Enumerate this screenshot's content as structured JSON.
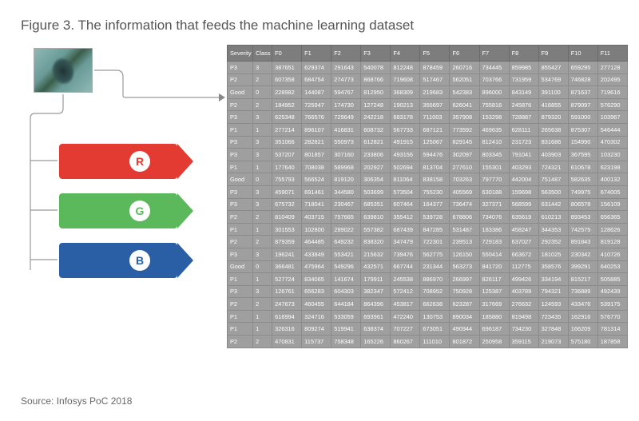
{
  "title": "Figure 3. The information that feeds the machine learning dataset",
  "source": "Source: Infosys PoC 2018",
  "channels": {
    "r": "R",
    "g": "G",
    "b": "B"
  },
  "columns": [
    "Severity",
    "Class",
    "F0",
    "F1",
    "F2",
    "F3",
    "F4",
    "F5",
    "F6",
    "F7",
    "F8",
    "F9",
    "F10",
    "F11"
  ],
  "rows": [
    [
      "P3",
      "3",
      "387651",
      "629374",
      "291643",
      "540078",
      "812248",
      "878459",
      "260716",
      "734445",
      "859985",
      "855427",
      "659295",
      "277128"
    ],
    [
      "P2",
      "2",
      "607358",
      "684754",
      "274773",
      "868766",
      "719608",
      "517467",
      "562051",
      "703766",
      "731959",
      "534769",
      "746828",
      "202495"
    ],
    [
      "Good",
      "0",
      "228982",
      "144087",
      "594767",
      "812950",
      "368309",
      "219683",
      "542383",
      "896000",
      "843149",
      "391100",
      "871637",
      "719616"
    ],
    [
      "P2",
      "2",
      "184952",
      "725947",
      "174730",
      "127248",
      "190213",
      "355697",
      "626041",
      "755816",
      "245876",
      "416855",
      "879097",
      "576290"
    ],
    [
      "P3",
      "3",
      "625348",
      "766576",
      "729649",
      "242218",
      "683178",
      "711003",
      "357908",
      "153298",
      "728887",
      "879320",
      "591000",
      "103967"
    ],
    [
      "P1",
      "1",
      "277214",
      "896107",
      "416831",
      "608732",
      "567733",
      "687121",
      "773592",
      "469635",
      "628111",
      "265638",
      "875307",
      "546444"
    ],
    [
      "P3",
      "3",
      "351066",
      "282821",
      "550973",
      "612821",
      "491915",
      "125067",
      "829145",
      "812410",
      "231723",
      "831686",
      "154990",
      "470302"
    ],
    [
      "P3",
      "3",
      "537207",
      "801857",
      "307160",
      "233806",
      "493156",
      "594476",
      "302097",
      "803345",
      "791041",
      "403903",
      "367595",
      "103230"
    ],
    [
      "P1",
      "1",
      "177640",
      "708038",
      "589968",
      "202927",
      "502694",
      "813704",
      "277610",
      "155301",
      "403293",
      "724321",
      "610678",
      "623198"
    ],
    [
      "Good",
      "0",
      "755793",
      "566524",
      "819120",
      "306354",
      "811064",
      "838158",
      "703263",
      "797770",
      "442004",
      "751487",
      "582635",
      "400132"
    ],
    [
      "P3",
      "3",
      "459071",
      "691461",
      "344580",
      "503699",
      "573504",
      "755230",
      "405569",
      "630188",
      "159698",
      "563500",
      "749975",
      "674005"
    ],
    [
      "P3",
      "3",
      "675732",
      "718041",
      "230467",
      "685351",
      "607464",
      "164377",
      "736474",
      "327371",
      "568599",
      "631442",
      "806578",
      "156109"
    ],
    [
      "P2",
      "2",
      "810409",
      "403715",
      "757665",
      "639810",
      "355412",
      "539728",
      "678806",
      "734076",
      "635619",
      "610213",
      "893453",
      "656365"
    ],
    [
      "P1",
      "1",
      "301553",
      "102800",
      "289022",
      "557382",
      "687439",
      "847285",
      "531487",
      "183386",
      "458247",
      "344353",
      "742575",
      "128626"
    ],
    [
      "P2",
      "2",
      "879359",
      "464485",
      "649232",
      "838320",
      "347479",
      "722301",
      "239513",
      "729183",
      "637027",
      "292352",
      "891843",
      "819128"
    ],
    [
      "P3",
      "3",
      "196241",
      "433849",
      "553421",
      "215632",
      "739476",
      "562775",
      "126150",
      "550414",
      "663672",
      "181025",
      "230342",
      "410726"
    ],
    [
      "Good",
      "0",
      "366481",
      "475964",
      "549296",
      "432571",
      "667744",
      "231344",
      "563273",
      "841720",
      "112775",
      "358576",
      "399291",
      "640253"
    ],
    [
      "P1",
      "1",
      "527724",
      "834065",
      "141674",
      "179911",
      "245538",
      "886970",
      "266997",
      "826117",
      "499426",
      "334194",
      "815217",
      "505885"
    ],
    [
      "P3",
      "3",
      "126761",
      "656283",
      "604303",
      "382347",
      "572412",
      "708952",
      "750928",
      "125387",
      "403789",
      "794321",
      "736889",
      "492439"
    ],
    [
      "P2",
      "2",
      "247673",
      "460455",
      "644184",
      "864396",
      "453817",
      "662638",
      "623287",
      "317669",
      "276632",
      "124593",
      "433476",
      "539175"
    ],
    [
      "P1",
      "1",
      "616994",
      "324716",
      "533059",
      "693961",
      "472240",
      "130753",
      "890034",
      "185880",
      "819498",
      "723435",
      "162916",
      "576770"
    ],
    [
      "P1",
      "1",
      "326316",
      "809274",
      "519941",
      "638374",
      "707227",
      "673051",
      "490944",
      "696187",
      "734230",
      "327848",
      "166209",
      "781314"
    ],
    [
      "P2",
      "2",
      "470831",
      "115737",
      "758348",
      "165226",
      "860267",
      "111010",
      "801872",
      "250958",
      "359115",
      "219073",
      "575180",
      "187858"
    ]
  ]
}
